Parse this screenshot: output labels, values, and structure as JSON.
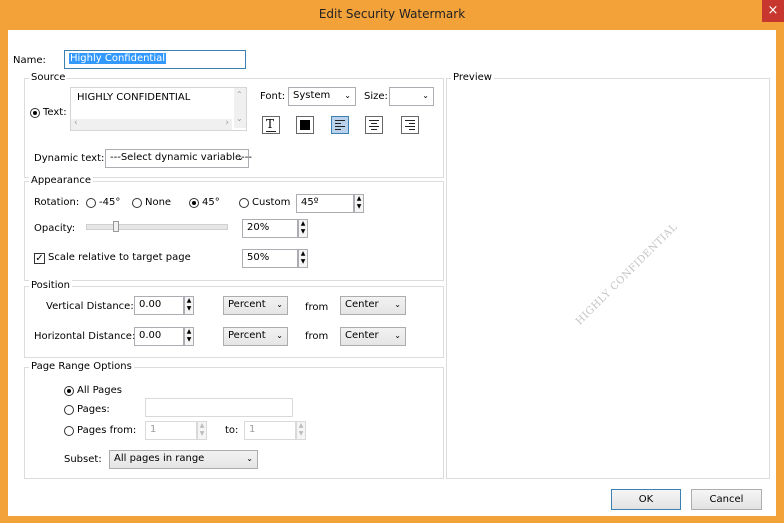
{
  "window": {
    "title": "Edit Security Watermark",
    "close_glyph": "×"
  },
  "name": {
    "label": "Name:",
    "value": "Highly Confidential"
  },
  "source": {
    "legend": "Source",
    "text_radio_label": "Text:",
    "text_value": "HIGHLY CONFIDENTIAL",
    "font_label": "Font:",
    "font_value": "System",
    "size_label": "Size:",
    "size_value": "",
    "dynamic_label": "Dynamic text:",
    "dynamic_value": "---Select dynamic variable---"
  },
  "appearance": {
    "legend": "Appearance",
    "rotation_label": "Rotation:",
    "rot_options": [
      "-45°",
      "None",
      "45°",
      "Custom"
    ],
    "rot_selected": "45°",
    "custom_value": "45º",
    "opacity_label": "Opacity:",
    "opacity_value": "20%",
    "opacity_level": 0.2,
    "scale_label": "Scale relative to target page",
    "scale_checked": true,
    "scale_value": "50%"
  },
  "position": {
    "legend": "Position",
    "vertical_label": "Vertical Distance:",
    "vertical_value": "0.00",
    "vertical_unit": "Percent",
    "vertical_from_label": "from",
    "vertical_from": "Center",
    "horizontal_label": "Horizontal Distance:",
    "horizontal_value": "0.00",
    "horizontal_unit": "Percent",
    "horizontal_from_label": "from",
    "horizontal_from": "Center"
  },
  "page_range": {
    "legend": "Page Range Options",
    "all_pages_label": "All Pages",
    "pages_label": "Pages:",
    "pages_value": "",
    "pages_from_label": "Pages from:",
    "from_value": "1",
    "to_label": "to:",
    "to_value": "1",
    "subset_label": "Subset:",
    "subset_value": "All pages in range"
  },
  "preview": {
    "legend": "Preview",
    "watermark_text": "HIGHLY CONFIDENTIAL"
  },
  "buttons": {
    "ok": "OK",
    "cancel": "Cancel"
  }
}
